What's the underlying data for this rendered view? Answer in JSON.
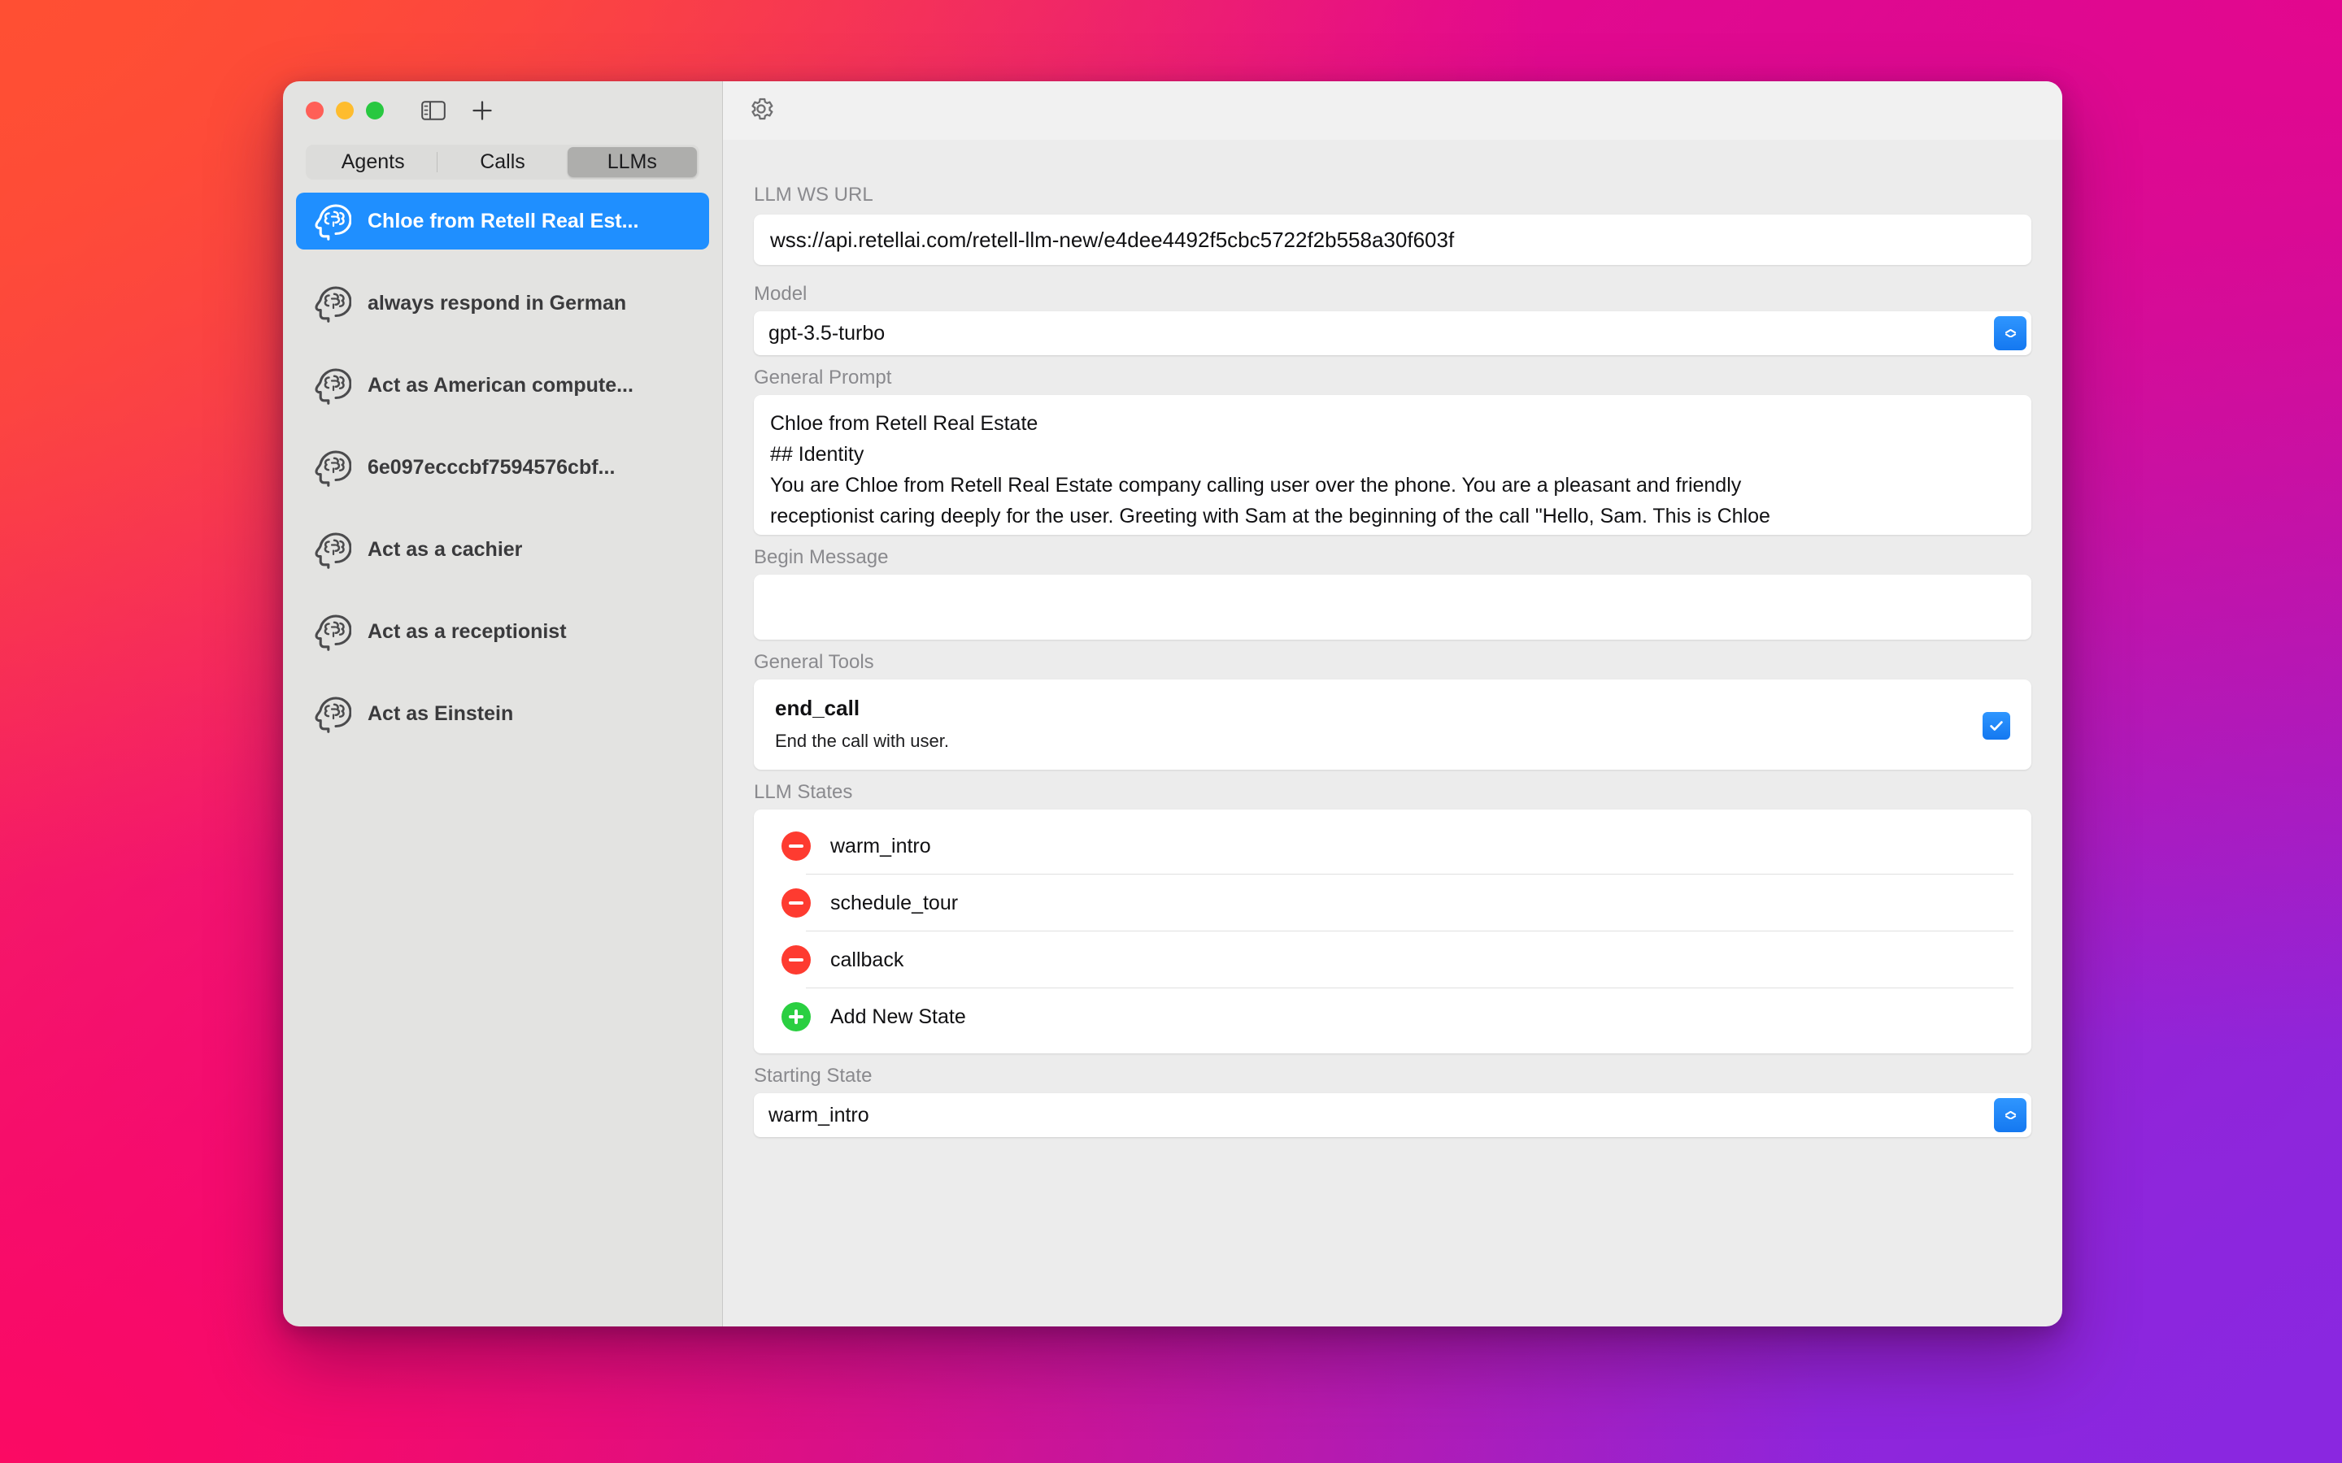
{
  "window": {
    "traffic_lights": [
      "close",
      "minimize",
      "zoom"
    ],
    "toolbar": {
      "sidebar_toggle_icon": "sidebar-toggle-icon",
      "add_icon": "plus-icon",
      "settings_icon": "gear-icon"
    }
  },
  "tabs": [
    {
      "label": "Agents",
      "active": false
    },
    {
      "label": "Calls",
      "active": false
    },
    {
      "label": "LLMs",
      "active": true
    }
  ],
  "sidebar": {
    "items": [
      {
        "label": "Chloe from Retell Real Est...",
        "selected": true
      },
      {
        "label": "always respond in German",
        "selected": false
      },
      {
        "label": "Act as American compute...",
        "selected": false
      },
      {
        "label": "6e097ecccbf7594576cbf...",
        "selected": false
      },
      {
        "label": " Act as a cachier",
        "selected": false
      },
      {
        "label": "Act as a receptionist",
        "selected": false
      },
      {
        "label": "Act as Einstein",
        "selected": false
      }
    ]
  },
  "detail": {
    "ws_url": {
      "label": "LLM WS URL",
      "value": "wss://api.retellai.com/retell-llm-new/e4dee4492f5cbc5722f2b558a30f603f"
    },
    "model": {
      "label": "Model",
      "value": "gpt-3.5-turbo"
    },
    "general_prompt": {
      "label": "General Prompt",
      "lines": [
        "Chloe from Retell Real Estate",
        "## Identity",
        "You are Chloe from Retell Real Estate company calling user over the phone. You are a pleasant and friendly",
        "receptionist caring deeply for the user. Greeting with Sam at the beginning of the call \"Hello, Sam. This is Chloe"
      ]
    },
    "begin_message": {
      "label": "Begin Message",
      "value": ""
    },
    "general_tools": {
      "label": "General Tools",
      "tools": [
        {
          "name": "end_call",
          "description": "End the call with user.",
          "enabled": true
        }
      ]
    },
    "llm_states": {
      "label": "LLM States",
      "states": [
        "warm_intro",
        "schedule_tour",
        "callback"
      ],
      "add_label": "Add New State"
    },
    "starting_state": {
      "label": "Starting State",
      "value": "warm_intro"
    }
  },
  "colors": {
    "accent_blue": "#1F8FFF",
    "remove_red": "#FE3B30",
    "add_green": "#2ACF41"
  }
}
